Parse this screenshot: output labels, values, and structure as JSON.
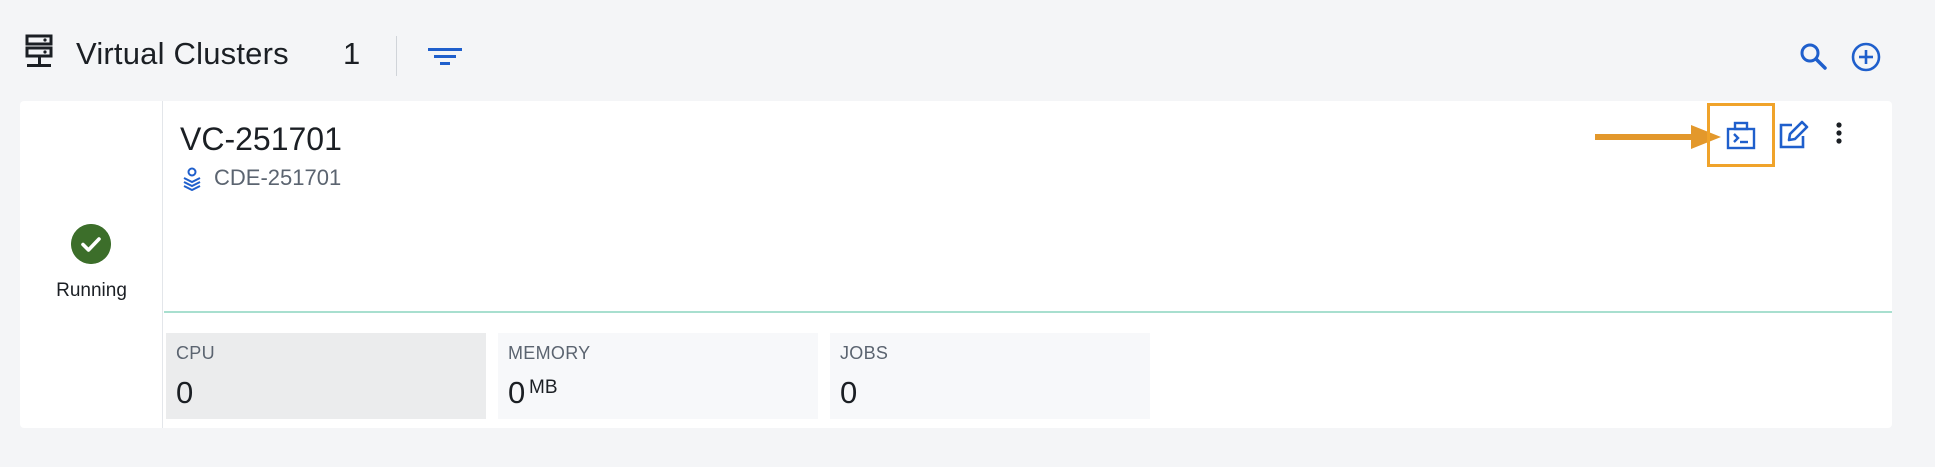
{
  "header": {
    "icon": "server-rack-icon",
    "title": "Virtual Clusters",
    "count": "1",
    "filter_icon": "filter-icon",
    "search_icon": "search-icon",
    "add_icon": "add-circle-icon"
  },
  "cluster": {
    "status": "Running",
    "status_icon": "check-circle-icon",
    "status_color": "#3c6e2a",
    "name": "VC-251701",
    "service_icon": "layers-user-icon",
    "service_name": "CDE-251701",
    "actions": {
      "terminal_icon": "terminal-window-icon",
      "edit_icon": "edit-icon",
      "more_icon": "more-vertical-icon"
    },
    "metrics": [
      {
        "label": "CPU",
        "value": "0",
        "unit": ""
      },
      {
        "label": "MEMORY",
        "value": "0",
        "unit": "MB"
      },
      {
        "label": "JOBS",
        "value": "0",
        "unit": ""
      }
    ]
  },
  "colors": {
    "accent": "#1f5fcc",
    "highlight": "#f0a32a",
    "running": "#3c6e2a",
    "divider": "#a8dfcf"
  }
}
